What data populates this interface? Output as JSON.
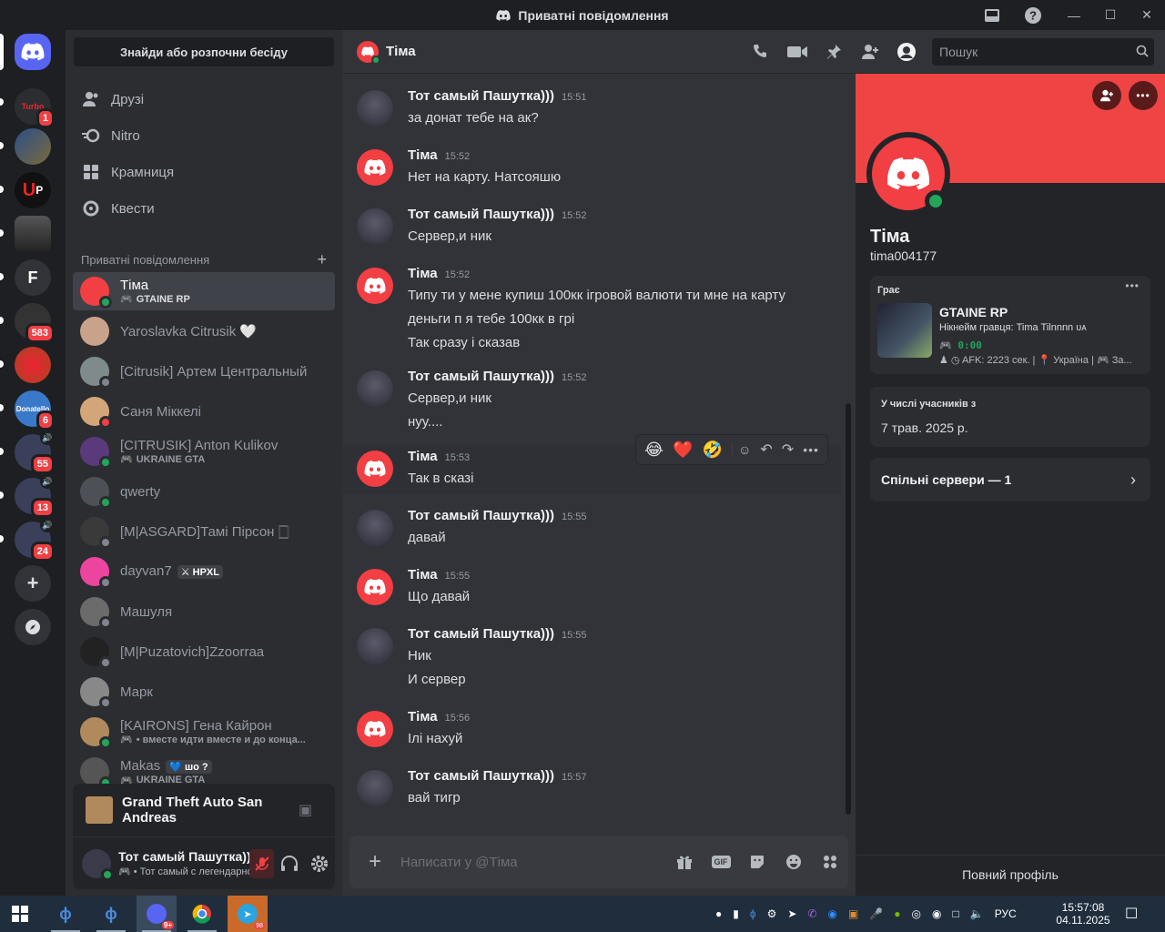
{
  "window": {
    "title": "Приватні повідомлення",
    "controls": [
      "minimize-icon",
      "maximize-icon",
      "close-icon"
    ]
  },
  "guilds": [
    {
      "name": "turbo-server",
      "badge": "1"
    },
    {
      "name": "server-2",
      "badge": ""
    },
    {
      "name": "up-server",
      "badge": ""
    },
    {
      "name": "vykup-avto",
      "badge": ""
    },
    {
      "name": "F",
      "badge": ""
    },
    {
      "name": "street-rp",
      "badge": "583"
    },
    {
      "name": "server-7",
      "badge": ""
    },
    {
      "name": "Donatello",
      "badge": "6"
    },
    {
      "name": "server-9",
      "badge": "55"
    },
    {
      "name": "server-10",
      "badge": "13"
    },
    {
      "name": "server-11",
      "badge": "24"
    }
  ],
  "dmcol": {
    "find_label": "Знайди або розпочни бесіду",
    "nav": [
      {
        "label": "Друзі",
        "icon": "friends-icon"
      },
      {
        "label": "Nitro",
        "icon": "nitro-icon"
      },
      {
        "label": "Крамниця",
        "icon": "shop-icon"
      },
      {
        "label": "Квести",
        "icon": "quests-icon"
      }
    ],
    "section_title": "Приватні повідомлення",
    "dms": [
      {
        "name": "Тіма",
        "sub": "GTAINE RP",
        "status": "online",
        "avatar": "#f23f43",
        "active": true
      },
      {
        "name": "Yaroslavka Citrusik 🤍",
        "sub": "",
        "status": "none",
        "avatar": "#c9a28a"
      },
      {
        "name": "[Citrusik] Артем Центральный",
        "sub": "",
        "status": "offline",
        "avatar": "#7f8a8c"
      },
      {
        "name": "Саня Міккелі",
        "sub": "",
        "status": "dnd",
        "avatar": "#d2a679"
      },
      {
        "name": "[CITRUSIK] Anton Kulikov",
        "sub": "UKRAINE GTA",
        "status": "online",
        "avatar": "#5a3a7a"
      },
      {
        "name": "qwerty",
        "sub": "",
        "status": "mobile",
        "avatar": "#4e5058"
      },
      {
        "name": "[M|ASGARD]Тамі Пірсон 🀆",
        "sub": "",
        "status": "offline",
        "avatar": "#3a3a3a"
      },
      {
        "name": "dayvan7",
        "tag": "⚔ HPXL",
        "sub": "",
        "status": "offline",
        "avatar": "#eb459e"
      },
      {
        "name": "Машуля",
        "sub": "",
        "status": "offline",
        "avatar": "#6b6b6b"
      },
      {
        "name": "[M|Puzatovich]Zzoorraa",
        "sub": "",
        "status": "offline",
        "avatar": "#222"
      },
      {
        "name": "Марк",
        "sub": "",
        "status": "offline",
        "avatar": "#888"
      },
      {
        "name": "[KAIRONS] Гена Кайрон",
        "sub": "• вместе идти вместе и до конца...",
        "status": "online",
        "avatar": "#b08a5c"
      },
      {
        "name": "Makas",
        "tag": "💙 шо ?",
        "sub": "UKRAINE GTA",
        "status": "online",
        "avatar": "#555"
      }
    ],
    "activity": {
      "title": "Grand Theft Auto San Andreas"
    },
    "user": {
      "name": "Тот самый Пашутка)))",
      "status": "• Тот самый с легендарной ..."
    }
  },
  "chat": {
    "title": "Тіма",
    "search_placeholder": "Пошук",
    "composer_placeholder": "Написати у @Тіма",
    "messages": [
      {
        "author": "Тот самый Пашутка)))",
        "time": "15:51",
        "lines": [
          "за донат тебе на ак?"
        ],
        "self": true
      },
      {
        "author": "Тіма",
        "time": "15:52",
        "lines": [
          "Нет на карту. Натсояшю"
        ],
        "self": false
      },
      {
        "author": "Тот самый Пашутка)))",
        "time": "15:52",
        "lines": [
          "Сервер,и ник"
        ],
        "self": true
      },
      {
        "author": "Тіма",
        "time": "15:52",
        "lines": [
          "Типу ти у мене купиш 100кк ігровой валюти ти мне на карту",
          "деньги п я тебе 100кк в грі",
          "Так сразу і сказав"
        ],
        "self": false
      },
      {
        "author": "Тот самый Пашутка)))",
        "time": "15:52",
        "lines": [
          "Сервер,и ник",
          "нуу...."
        ],
        "self": true
      },
      {
        "author": "Тіма",
        "time": "15:53",
        "lines": [
          "Так в сказі"
        ],
        "self": false
      },
      {
        "author": "Тот самый Пашутка)))",
        "time": "15:55",
        "lines": [
          "давай"
        ],
        "self": true
      },
      {
        "author": "Тіма",
        "time": "15:55",
        "lines": [
          "Що давай"
        ],
        "self": false
      },
      {
        "author": "Тот самый Пашутка)))",
        "time": "15:55",
        "lines": [
          "Ник",
          "И сервер"
        ],
        "self": true
      },
      {
        "author": "Тіма",
        "time": "15:56",
        "lines": [
          "Ілі нахуй"
        ],
        "self": false
      },
      {
        "author": "Тот самый Пашутка)))",
        "time": "15:57",
        "lines": [
          "вай тигр"
        ],
        "self": true
      }
    ],
    "reactions": [
      "😂",
      "❤️",
      "🤣"
    ]
  },
  "profile": {
    "display_name": "Тіма",
    "username": "tima004177",
    "playing_label": "Грає",
    "game": "GTAINE RP",
    "game_nick": "Нікнейм гравця: Tima Tilnnnn ᴜᴀ",
    "game_timer": "0:00",
    "game_details": "AFK: 2223 сек. | 📍 Україна | 🎮 За...",
    "member_since_label": "У числі учасників з",
    "member_since": "7 трав. 2025 р.",
    "mutual_servers": "Спільні сервери — 1",
    "full_profile": "Повний профіль"
  },
  "taskbar": {
    "lang": "РУС",
    "time": "15:57:08",
    "date": "04.11.2025",
    "discord_badge": "9+",
    "telegram_badge": "98"
  }
}
